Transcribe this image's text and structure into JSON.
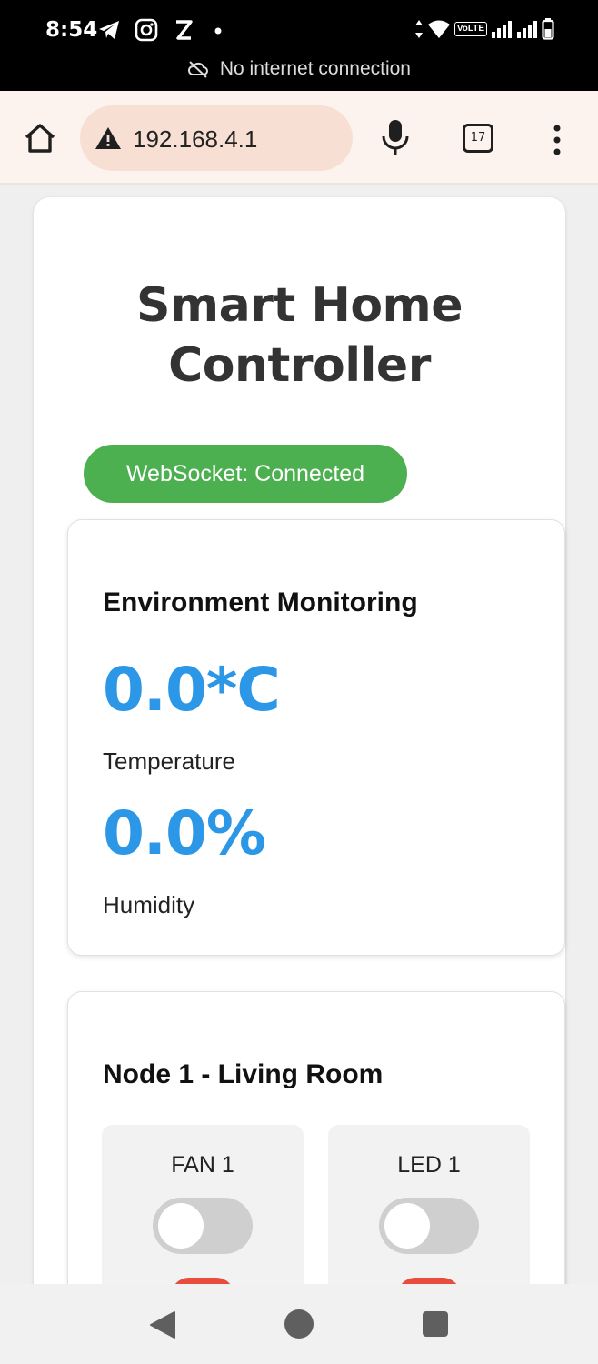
{
  "status_bar": {
    "time": "8:54",
    "icons_left": [
      "telegram-icon",
      "instagram-icon",
      "z-app-icon",
      "dot-icon"
    ],
    "volte": "VoLTE",
    "network_message": "No internet connection"
  },
  "browser": {
    "url": "192.168.4.1",
    "tab_count": "17"
  },
  "page": {
    "title": "Smart Home Controller",
    "ws_status": "WebSocket: Connected",
    "environment": {
      "heading": "Environment Monitoring",
      "temperature_value": "0.0*C",
      "temperature_label": "Temperature",
      "humidity_value": "0.0%",
      "humidity_label": "Humidity"
    },
    "node1": {
      "heading": "Node 1 - Living Room",
      "devices": [
        {
          "name": "FAN 1",
          "on": false
        },
        {
          "name": "LED 1",
          "on": false
        }
      ]
    }
  },
  "colors": {
    "accent_blue": "#2b97e6",
    "connected_green": "#4cb050",
    "off_red": "#e74c3c"
  }
}
